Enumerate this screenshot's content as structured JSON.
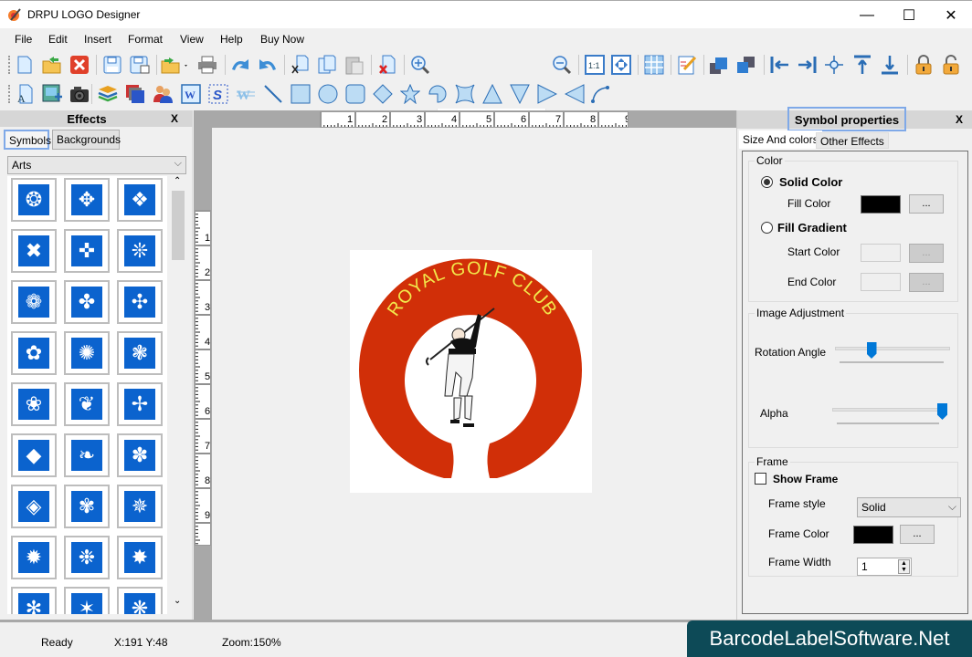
{
  "window": {
    "title": "DRPU LOGO Designer",
    "controls": {
      "minimize": "—",
      "maximize": "☐",
      "close": "✕"
    }
  },
  "menu": [
    "File",
    "Edit",
    "Insert",
    "Format",
    "View",
    "Help",
    "Buy Now"
  ],
  "toolbar1": {
    "icons": [
      "new-icon",
      "open-icon",
      "close-file-icon",
      "save-icon",
      "save-as-icon",
      "import-icon",
      "print-icon",
      "undo-icon",
      "redo-icon",
      "cut-icon",
      "copy-icon",
      "paste-icon",
      "delete-icon",
      "zoom-in-icon",
      "zoom-out-icon",
      "actual-size-icon",
      "fit-page-icon",
      "grid-icon",
      "edit-properties-icon",
      "bring-forward-icon",
      "send-backward-icon",
      "align-left-icon",
      "align-right-icon",
      "align-center-icon",
      "align-top-icon",
      "align-bottom-icon",
      "lock-icon",
      "unlock-icon"
    ],
    "zoom_value": "150%"
  },
  "toolbar2": {
    "icons": [
      "text-icon",
      "image-icon",
      "camera-icon",
      "layers-icon",
      "background-icon",
      "users-icon",
      "word-art-icon",
      "signature-icon",
      "watermark-icon",
      "line-icon",
      "rectangle-icon",
      "ellipse-icon",
      "rounded-rect-icon",
      "diamond-icon",
      "star-icon",
      "arc-icon",
      "cross-icon",
      "triangle-icon",
      "inverted-triangle-icon",
      "right-triangle-icon",
      "left-triangle-icon",
      "curve-icon"
    ]
  },
  "effects_panel": {
    "title": "Effects",
    "close": "X",
    "tabs": [
      "Symbols",
      "Backgrounds"
    ],
    "active_tab": "Symbols",
    "category": "Arts",
    "symbols": [
      "❂",
      "✥",
      "❖",
      "✖",
      "✜",
      "❊",
      "❁",
      "✤",
      "✣",
      "✿",
      "✺",
      "❃",
      "❀",
      "❦",
      "✢",
      "◆",
      "❧",
      "✽",
      "◈",
      "✾",
      "✵",
      "✹",
      "❉",
      "✸",
      "✻",
      "✶",
      "❋"
    ]
  },
  "canvas": {
    "hruler": [
      "1",
      "2",
      "3",
      "4",
      "5",
      "6",
      "7",
      "8",
      "9"
    ],
    "vruler": [
      "1",
      "2",
      "3",
      "4",
      "5",
      "6",
      "7",
      "8",
      "9"
    ],
    "logo": {
      "text": "ROYAL GOLF CLUB",
      "ring_color": "#d12f08",
      "text_color": "#f2e84b"
    }
  },
  "properties_panel": {
    "title": "Symbol properties",
    "close": "X",
    "tabs": [
      "Size And colors",
      "Other Effects"
    ],
    "active_tab": "Size And colors",
    "color_group": {
      "legend": "Color",
      "solid_color": "Solid Color",
      "fill_color": "Fill Color",
      "fill_color_value": "#000000",
      "fill_gradient": "Fill Gradient",
      "start_color": "Start Color",
      "end_color": "End Color",
      "selected": "Solid Color",
      "browse": "..."
    },
    "image_adjustment": {
      "legend": "Image Adjustment",
      "rotation_label": "Rotation Angle",
      "rotation_fraction": 0.3,
      "alpha_label": "Alpha",
      "alpha_fraction": 1.0
    },
    "frame": {
      "legend": "Frame",
      "show_frame": "Show Frame",
      "show_frame_checked": false,
      "style_label": "Frame style",
      "style_value": "Solid",
      "color_label": "Frame Color",
      "color_value": "#000000",
      "width_label": "Frame Width",
      "width_value": "1",
      "browse": "..."
    }
  },
  "status": {
    "state": "Ready",
    "coords": "X:191  Y:48",
    "zoom": "Zoom:150%"
  },
  "watermark": "BarcodeLabelSoftware.Net"
}
